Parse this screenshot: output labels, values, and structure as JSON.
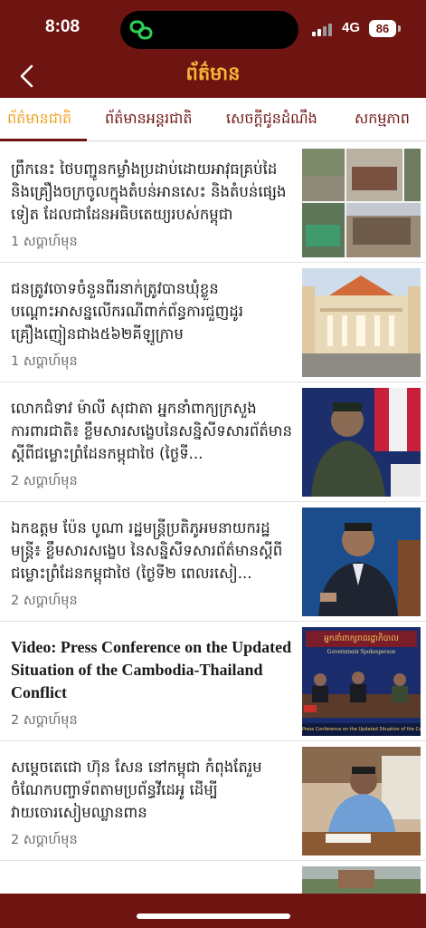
{
  "status_bar": {
    "time": "8:08",
    "network": "4G",
    "battery": "86"
  },
  "header": {
    "title": "ព័ត៌មាន",
    "back_icon": "chevron-left-icon"
  },
  "tabs": [
    {
      "label": "ព័ត៌មានជាតិ",
      "active": true
    },
    {
      "label": "ព័ត៌មានអន្តរជាតិ",
      "active": false
    },
    {
      "label": "សេចក្តីជូនដំណឹង",
      "active": false
    },
    {
      "label": "សកម្មភាព",
      "active": false
    }
  ],
  "news": [
    {
      "headline": "ព្រឹកនេះ ថៃបញ្ជូនកម្លាំងប្រដាប់ដោយអាវុធគ្រប់ដៃ និងគ្រឿងចក្រចូលក្នុងតំបន់អានសេះ និងតំបន់ផ្សេងទៀត ដែលជាដែនអធិបតេយ្យរបស់កម្ពុជា",
      "time_ago": "1 សប្តាហ៍មុន"
    },
    {
      "headline": "ជនត្រូវចោទចំនួនពីរនាក់ត្រូវបានឃុំខ្លួន បណ្ដោះអាសន្នលើករណីពាក់ព័ន្ធការជួញដូរគ្រឿងញៀនជាង៥៦២គីឡូក្រាម",
      "time_ago": "1 សប្តាហ៍មុន"
    },
    {
      "headline": "លោកជំទាវ ម៉ាលី សុជាតា អ្នកនាំពាក្យក្រសួងការពារជាតិ៖ ខ្លឹមសារសង្ខេបនៃសន្និសីទសារព័ត៌មានស្តីពីជម្លោះព្រំដែនកម្ពុជាថៃ (ថ្ងៃទី...",
      "time_ago": "2 សប្តាហ៍មុន"
    },
    {
      "headline": "ឯកឧត្តម ប៉ែន បូណា រដ្ឋមន្ត្រីប្រតិភូអមនាយករដ្ឋមន្ត្រី៖ ខ្លឹមសារសង្ខេប នៃសន្និសីទសារព័ត៌មានស្តីពីជម្លោះព្រំដែនកម្ពុជាថៃ (ថ្ងៃទី២ ពេលរសៀ...",
      "time_ago": "2 សប្តាហ៍មុន"
    },
    {
      "headline": "Video: Press Conference on the Updated Situation of the Cambodia-Thailand Conflict",
      "time_ago": "2 សប្តាហ៍មុន",
      "thumb_banner": "អ្នកនាំពាក្យរាជរដ្ឋាភិបាល",
      "thumb_sub": "Government Spokesperson",
      "thumb_caption": "Press Conference on the Updated Situation of the Cambodia-Thailand Conf"
    },
    {
      "headline": "សម្ដេចតេជោ ហ៊ុន សែន នៅកម្ពុជា កំពុងតែរួមចំណែកបញ្ចាទ័ពតាមប្រព័ន្ធវីដេអូ ដើម្បីវាយចោរសៀមឈ្លានពាន",
      "time_ago": "2 សប្តាហ៍មុន"
    }
  ],
  "colors": {
    "brand": "#6f1511",
    "accent": "#f5b53a",
    "active_tab": "#f0a21f"
  }
}
